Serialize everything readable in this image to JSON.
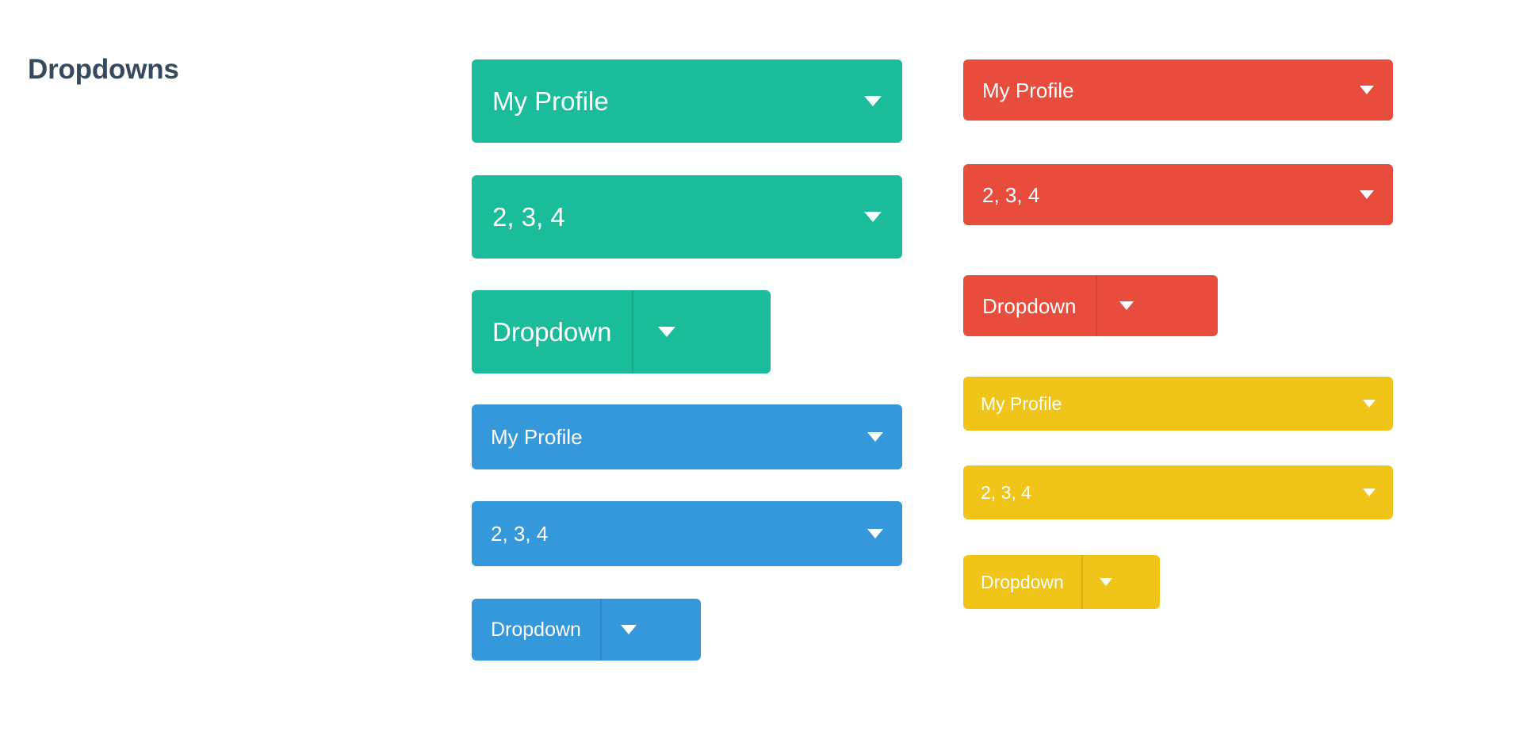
{
  "page": {
    "title": "Dropdowns",
    "background": "#ffffff",
    "title_color": "#36495d"
  },
  "colors": {
    "green": "#1abc9c",
    "blue": "#3498db",
    "red": "#e74c3c",
    "yellow": "#f0c419",
    "text_on_fill": "#ffffff"
  },
  "columns": {
    "left": {
      "name": "primary-column",
      "groups": [
        {
          "name": "green-group",
          "color_key": "green",
          "items": [
            {
              "label": "My Profile",
              "style": "full",
              "size": "lg",
              "caret": "chevron-down-icon"
            },
            {
              "label": "2, 3, 4",
              "style": "full",
              "size": "lg",
              "caret": "chevron-down-icon"
            },
            {
              "label": "Dropdown",
              "style": "split",
              "size": "lg",
              "caret": "chevron-down-icon"
            }
          ]
        },
        {
          "name": "blue-group",
          "color_key": "blue",
          "items": [
            {
              "label": "My Profile",
              "style": "full",
              "size": "md",
              "caret": "chevron-down-icon"
            },
            {
              "label": "2, 3, 4",
              "style": "full",
              "size": "md",
              "caret": "chevron-down-icon"
            },
            {
              "label": "Dropdown",
              "style": "split",
              "size": "md",
              "caret": "chevron-down-icon"
            }
          ]
        }
      ]
    },
    "right": {
      "name": "secondary-column",
      "groups": [
        {
          "name": "red-group",
          "color_key": "red",
          "items": [
            {
              "label": "My Profile",
              "style": "full",
              "size": "sm",
              "caret": "chevron-down-icon"
            },
            {
              "label": "2, 3, 4",
              "style": "full",
              "size": "sm",
              "caret": "chevron-down-icon"
            },
            {
              "label": "Dropdown",
              "style": "split",
              "size": "sm",
              "caret": "chevron-down-icon"
            }
          ]
        },
        {
          "name": "yellow-group",
          "color_key": "yellow",
          "items": [
            {
              "label": "My Profile",
              "style": "full",
              "size": "xs",
              "caret": "chevron-down-icon"
            },
            {
              "label": "2, 3, 4",
              "style": "full",
              "size": "xs",
              "caret": "chevron-down-icon"
            },
            {
              "label": "Dropdown",
              "style": "split",
              "size": "xs",
              "caret": "chevron-down-icon"
            }
          ]
        }
      ]
    }
  }
}
